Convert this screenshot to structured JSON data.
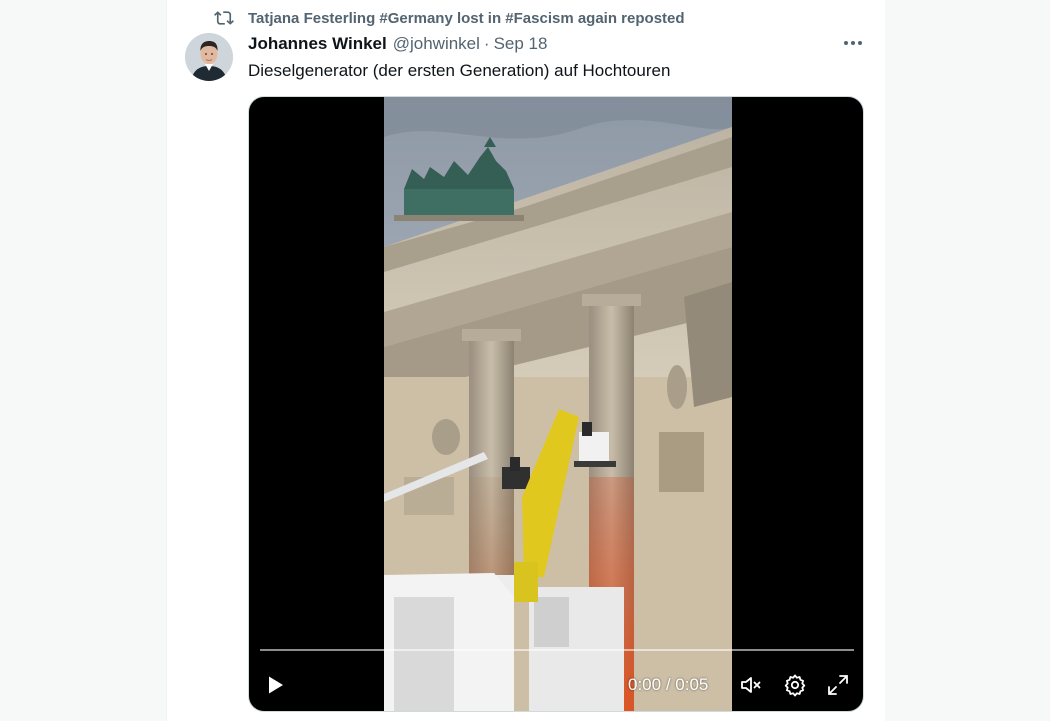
{
  "repost": {
    "text": "Tatjana Festerling #Germany lost in #Fascism again reposted",
    "icon": "repost-icon"
  },
  "tweet": {
    "author_name": "Johannes Winkel",
    "handle": "@johwinkel",
    "separator": "·",
    "date": "Sep 18",
    "text": "Dieselgenerator (der ersten Generation) auf Hochtouren",
    "more_icon": "more-dots-icon"
  },
  "video": {
    "current_time": "0:00",
    "time_separator": " / ",
    "duration": "0:05",
    "progress": 0,
    "controls": {
      "play_icon": "play-icon",
      "mute_icon": "volume-muted-icon",
      "settings_icon": "gear-icon",
      "fullscreen_icon": "fullscreen-icon"
    }
  },
  "colors": {
    "secondary_text": "#536471",
    "primary_text": "#0f1419",
    "media_background": "#000000"
  }
}
